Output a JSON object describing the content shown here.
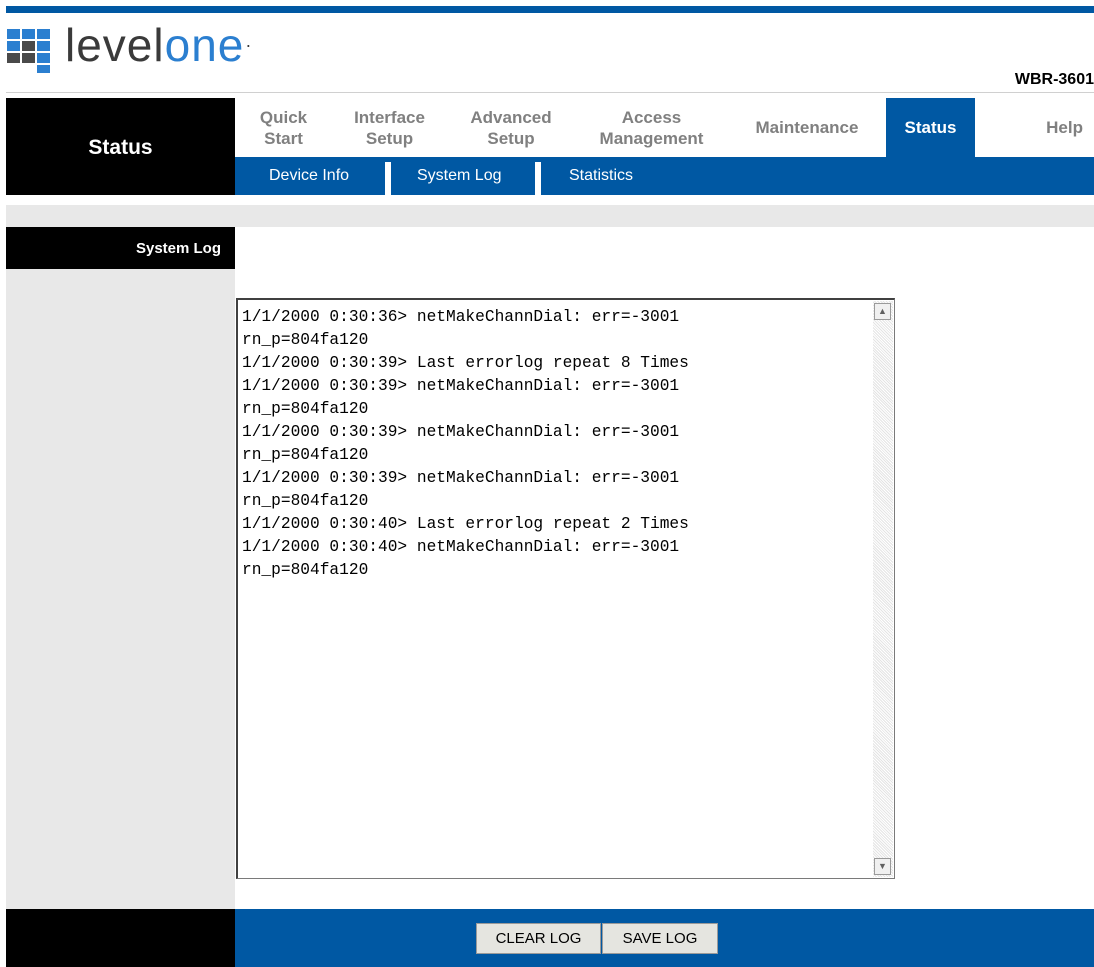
{
  "brand": {
    "logo_text_a": "level",
    "logo_text_b": "one",
    "model": "WBR-3601"
  },
  "colors": {
    "primary_blue": "#0058a3",
    "black": "#000000",
    "grey_panel": "#e8e8e8"
  },
  "section": {
    "title": "Status"
  },
  "nav": {
    "tabs": [
      {
        "label": "Quick\nStart",
        "active": false
      },
      {
        "label": "Interface\nSetup",
        "active": false
      },
      {
        "label": "Advanced\nSetup",
        "active": false
      },
      {
        "label": "Access\nManagement",
        "active": false
      },
      {
        "label": "Maintenance",
        "active": false
      },
      {
        "label": "Status",
        "active": true
      },
      {
        "label": "Help",
        "active": false
      }
    ],
    "subtabs": [
      {
        "label": "Device Info"
      },
      {
        "label": "System Log"
      },
      {
        "label": "Statistics"
      }
    ]
  },
  "sidebar": {
    "heading": "System Log"
  },
  "log": {
    "lines": [
      "1/1/2000 0:30:36> netMakeChannDial: err=-3001",
      "rn_p=804fa120",
      "1/1/2000 0:30:39> Last errorlog repeat 8 Times",
      "1/1/2000 0:30:39> netMakeChannDial: err=-3001",
      "rn_p=804fa120",
      "1/1/2000 0:30:39> netMakeChannDial: err=-3001",
      "rn_p=804fa120",
      "1/1/2000 0:30:39> netMakeChannDial: err=-3001",
      "rn_p=804fa120",
      "1/1/2000 0:30:40> Last errorlog repeat 2 Times",
      "1/1/2000 0:30:40> netMakeChannDial: err=-3001",
      "rn_p=804fa120"
    ]
  },
  "buttons": {
    "clear_log": "CLEAR LOG",
    "save_log": "SAVE LOG"
  }
}
